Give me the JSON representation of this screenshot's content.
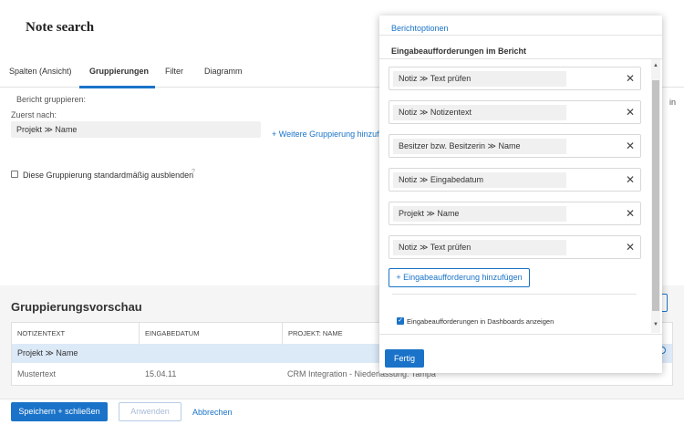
{
  "page": {
    "title": "Note search"
  },
  "tabs": [
    "Spalten (Ansicht)",
    "Gruppierungen",
    "Filter",
    "Diagramm"
  ],
  "grouping": {
    "heading": "Bericht gruppieren:",
    "first_label": "Zuerst nach:",
    "first_value": "Projekt ≫ Name",
    "add_link": "+ Weitere Gruppierung hinzufü",
    "hide_checkbox": "Diese Gruppierung standardmäßig ausblenden",
    "help": "?",
    "cut_text": "in"
  },
  "preview": {
    "title": "Gruppierungsvorschau",
    "columns": [
      "NOTIZENTEXT",
      "EINGABEDATUM",
      "PROJEKT: NAME"
    ],
    "group_row": "Projekt ≫ Name",
    "row": [
      "Mustertext",
      "15.04.11",
      "CRM Integration - Niederlassung: Tampa"
    ]
  },
  "footer": {
    "save_close": "Speichern + schließen",
    "apply": "Anwenden",
    "cancel": "Abbrechen"
  },
  "panel": {
    "header": "Berichtoptionen",
    "subheader": "Eingabeaufforderungen im Bericht",
    "prompts": [
      "Notiz ≫ Text prüfen",
      "Notiz ≫ Notizentext",
      "Besitzer bzw. Besitzerin ≫ Name",
      "Notiz ≫ Eingabedatum",
      "Projekt ≫ Name",
      "Notiz ≫ Text prüfen"
    ],
    "close_glyph": "✕",
    "add_prompt": "+ Eingabeaufforderung hinzufügen",
    "show_in_dashboards": "Eingabeaufforderungen in Dashboards anzeigen",
    "done": "Fertig"
  },
  "colors": {
    "accent": "#1a73c8",
    "group_row_bg": "#dce9f7"
  }
}
